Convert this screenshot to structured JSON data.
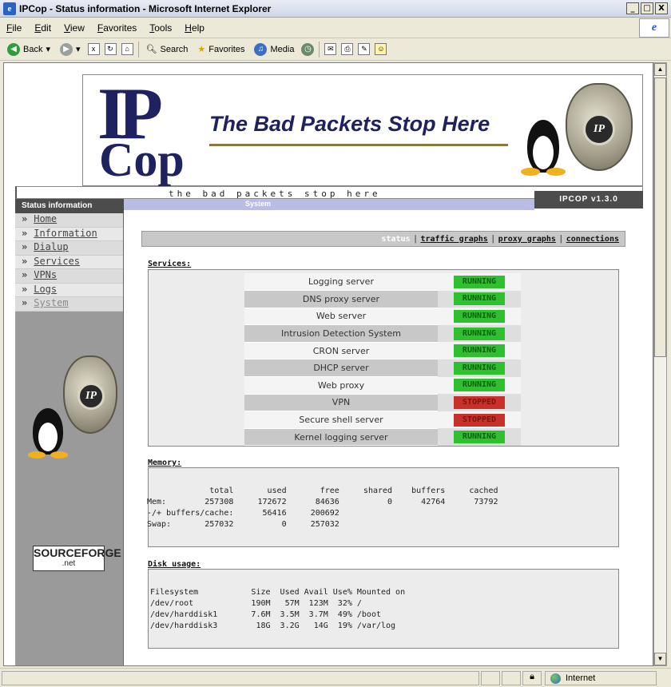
{
  "window": {
    "title": "IPCop - Status information - Microsoft Internet Explorer",
    "app_icon": "ie-icon",
    "controls": [
      "_",
      "□",
      "X"
    ]
  },
  "menu": [
    "File",
    "Edit",
    "View",
    "Favorites",
    "Tools",
    "Help"
  ],
  "toolbar": {
    "back": "Back",
    "search": "Search",
    "favorites": "Favorites",
    "media": "Media"
  },
  "status_bar": {
    "zone": "Internet"
  },
  "banner": {
    "logo_top": "IP",
    "logo_bottom": "Cop",
    "tagline": "The Bad Packets Stop Here"
  },
  "header": {
    "motto": "the bad packets stop here",
    "version": "IPCOP v1.3.0",
    "section": "Status information",
    "subsection": "System"
  },
  "sidebar": {
    "items": [
      {
        "label": "Home",
        "dim": false
      },
      {
        "label": "Information",
        "dim": false
      },
      {
        "label": "Dialup",
        "dim": false
      },
      {
        "label": "Services",
        "dim": false
      },
      {
        "label": "VPNs",
        "dim": false
      },
      {
        "label": "Logs",
        "dim": false
      },
      {
        "label": "System",
        "dim": true
      }
    ],
    "sourceforge_top": "SOURCEFORGE",
    "sourceforge_bottom": ".net"
  },
  "tabs": [
    {
      "label": "status",
      "active": true
    },
    {
      "label": "traffic graphs",
      "active": false
    },
    {
      "label": "proxy graphs",
      "active": false
    },
    {
      "label": "connections",
      "active": false
    }
  ],
  "services": {
    "title": "Services:",
    "colors": {
      "running": "#2fc02f",
      "stopped": "#c8302a"
    },
    "rows": [
      {
        "name": "Logging server",
        "status": "RUNNING",
        "state": "running"
      },
      {
        "name": "DNS proxy server",
        "status": "RUNNING",
        "state": "running"
      },
      {
        "name": "Web server",
        "status": "RUNNING",
        "state": "running"
      },
      {
        "name": "Intrusion Detection System",
        "status": "RUNNING",
        "state": "running"
      },
      {
        "name": "CRON server",
        "status": "RUNNING",
        "state": "running"
      },
      {
        "name": "DHCP server",
        "status": "RUNNING",
        "state": "running"
      },
      {
        "name": "Web proxy",
        "status": "RUNNING",
        "state": "running"
      },
      {
        "name": "VPN",
        "status": "STOPPED",
        "state": "stopped"
      },
      {
        "name": "Secure shell server",
        "status": "STOPPED",
        "state": "stopped"
      },
      {
        "name": "Kernel logging server",
        "status": "RUNNING",
        "state": "running"
      }
    ]
  },
  "memory": {
    "title": "Memory:",
    "text": "             total       used       free     shared    buffers     cached\nMem:        257308     172672      84636          0      42764      73792\n-/+ buffers/cache:      56416     200692\nSwap:       257032          0     257032"
  },
  "disk": {
    "title": "Disk usage:",
    "text": "Filesystem           Size  Used Avail Use% Mounted on\n/dev/root            190M   57M  123M  32% /\n/dev/harddisk1       7.6M  3.5M  3.7M  49% /boot\n/dev/harddisk3        18G  3.2G   14G  19% /var/log"
  }
}
